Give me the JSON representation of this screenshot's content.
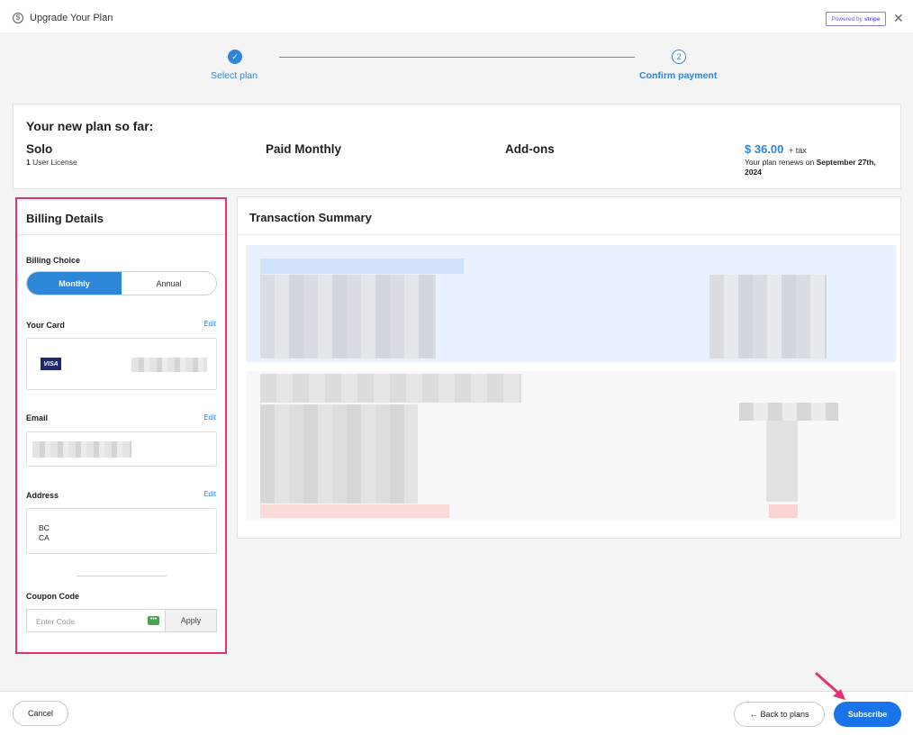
{
  "window": {
    "title": "Upgrade Your Plan",
    "powered_by": "Powered by",
    "powered_brand": "stripe",
    "close": "✕"
  },
  "stepper": {
    "steps": [
      {
        "label": "Select plan",
        "state": "done",
        "glyph": "✓"
      },
      {
        "label": "Confirm payment",
        "state": "current",
        "glyph": "2"
      }
    ]
  },
  "plan": {
    "heading": "Your new plan so far:",
    "name": "Solo",
    "licenses_count": "1",
    "licenses_label": "User License",
    "billing": "Paid Monthly",
    "addons": "Add-ons",
    "price": "$ 36.00",
    "tax": "+ tax",
    "renew_prefix": "Your plan renews on",
    "renew_date": "September 27th, 2024"
  },
  "billing_details": {
    "title": "Billing Details",
    "choice_label": "Billing Choice",
    "options": [
      "Monthly",
      "Annual"
    ],
    "selected": "Monthly",
    "card_label": "Your Card",
    "card_brand": "VISA",
    "email_label": "Email",
    "address_label": "Address",
    "address_lines": [
      "BC",
      "CA"
    ],
    "edit": "Edit",
    "coupon_label": "Coupon Code",
    "coupon_placeholder": "Enter Code",
    "apply": "Apply"
  },
  "transaction": {
    "title": "Transaction Summary"
  },
  "footer": {
    "cancel": "Cancel",
    "back_arrow": "←",
    "back": "Back to plans",
    "subscribe": "Subscribe"
  },
  "colors": {
    "accent": "#2e86d9",
    "primary_button": "#1a73e8",
    "highlight": "#e8306e"
  },
  "icons": [
    "upgrade-icon",
    "close-icon",
    "check-icon",
    "visa-card-icon",
    "keyboard-icon",
    "back-arrow-icon"
  ]
}
